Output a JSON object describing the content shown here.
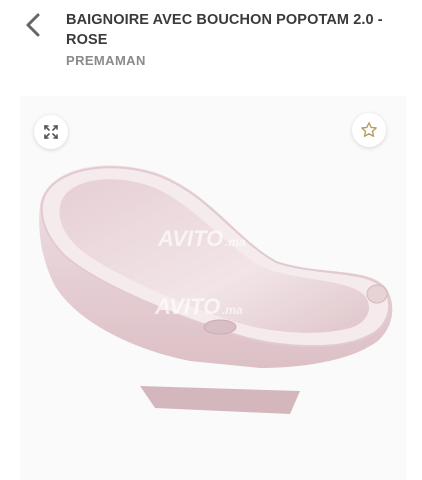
{
  "header": {
    "back_icon": "chevron-left-icon",
    "title_line1": "BAIGNOIRE AVEC BOUCHON POPOTAM 2.0 -",
    "title_line2": "ROSE",
    "brand": "PREMAMAN"
  },
  "product_image": {
    "expand_icon": "expand-arrows-icon",
    "favorite_icon": "star-outline-icon",
    "watermark_text": "AVITO",
    "watermark_suffix": ".ma",
    "tub_color": "#ead5d9",
    "accent_gold": "#b49a5e"
  }
}
